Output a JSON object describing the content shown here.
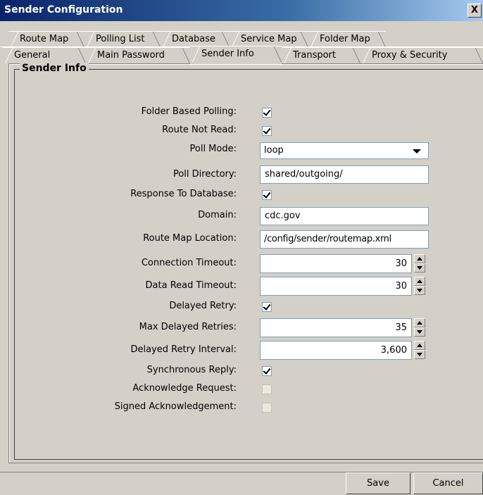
{
  "window": {
    "title": "Sender Configuration",
    "close_glyph": "X"
  },
  "tabs": {
    "row1": [
      "Route Map",
      "Polling List",
      "Database",
      "Service Map",
      "Folder Map"
    ],
    "row2": [
      "General",
      "Main Password",
      "Sender Info",
      "Transport",
      "Proxy & Security"
    ],
    "active": "Sender Info"
  },
  "section": {
    "title": "Sender Info"
  },
  "fields": {
    "folder_based_polling": {
      "label": "Folder Based Polling:",
      "checked": true
    },
    "route_not_read": {
      "label": "Route Not Read:",
      "checked": true
    },
    "poll_mode": {
      "label": "Poll Mode:",
      "value": "loop"
    },
    "poll_directory": {
      "label": "Poll Directory:",
      "value": "shared/outgoing/"
    },
    "response_to_database": {
      "label": "Response To Database:",
      "checked": true
    },
    "domain": {
      "label": "Domain:",
      "value": "cdc.gov"
    },
    "route_map_location": {
      "label": "Route Map Location:",
      "value": "/config/sender/routemap.xml"
    },
    "connection_timeout": {
      "label": "Connection Timeout:",
      "value": "30"
    },
    "data_read_timeout": {
      "label": "Data Read Timeout:",
      "value": "30"
    },
    "delayed_retry": {
      "label": "Delayed Retry:",
      "checked": true
    },
    "max_delayed_retries": {
      "label": "Max Delayed Retries:",
      "value": "35"
    },
    "delayed_retry_interval": {
      "label": "Delayed Retry Interval:",
      "value": "3,600"
    },
    "synchronous_reply": {
      "label": "Synchronous Reply:",
      "checked": true
    },
    "acknowledge_request": {
      "label": "Acknowledge Request:",
      "checked": false
    },
    "signed_acknowledgement": {
      "label": "Signed Acknowledgement:",
      "checked": false
    }
  },
  "buttons": {
    "save": "Save",
    "cancel": "Cancel"
  }
}
